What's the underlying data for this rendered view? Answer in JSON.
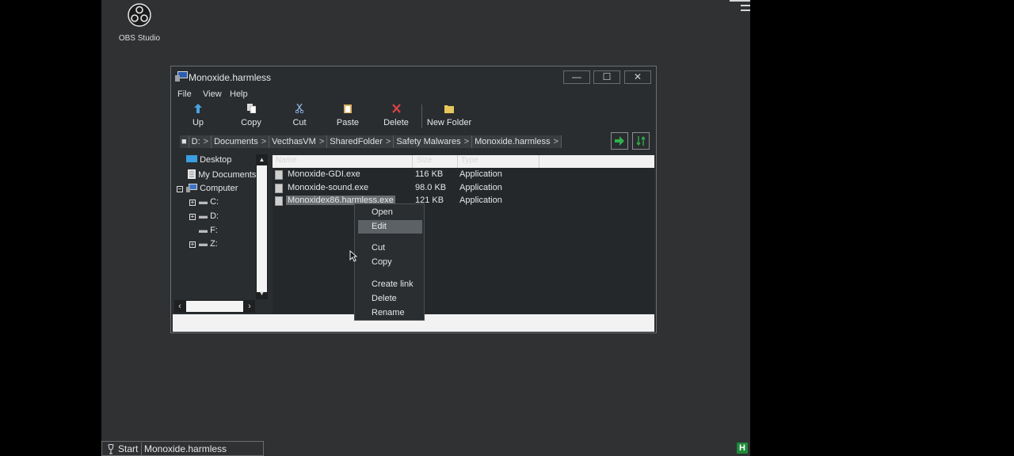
{
  "desktop": {
    "icons": [
      {
        "label": "OBS Studio",
        "icon": "obs-logo-icon"
      }
    ]
  },
  "window": {
    "title": "Monoxide.harmless",
    "controls": {
      "minimize": "—",
      "maximize": "☐",
      "close": "✕"
    },
    "menu": [
      "File",
      "View",
      "Help"
    ],
    "toolbar": [
      {
        "label": "Up",
        "icon": "up-arrow-icon"
      },
      {
        "label": "Copy",
        "icon": "copy-icon"
      },
      {
        "label": "Cut",
        "icon": "scissors-icon"
      },
      {
        "label": "Paste",
        "icon": "paste-icon"
      },
      {
        "label": "Delete",
        "icon": "delete-icon"
      },
      {
        "label": "New Folder",
        "icon": "folder-icon"
      }
    ],
    "address_bar": {
      "crumbs": [
        "D:",
        "Documents",
        "VecthasVM",
        "SharedFolder",
        "Safety Malwares",
        "Monoxide.harmless"
      ],
      "separator": ">"
    },
    "tree": {
      "items": [
        {
          "label": "Desktop"
        },
        {
          "label": "My Documents"
        },
        {
          "label": "Computer"
        },
        {
          "label": "C:"
        },
        {
          "label": "D:"
        },
        {
          "label": "F:"
        },
        {
          "label": "Z:"
        }
      ]
    },
    "file_list": {
      "columns": [
        "Name",
        "Size",
        "Type"
      ],
      "rows": [
        {
          "name": "Monoxide-GDI.exe",
          "size": "116 KB",
          "type": "Application"
        },
        {
          "name": "Monoxide-sound.exe",
          "size": "98.0 KB",
          "type": "Application"
        },
        {
          "name": "Monoxidex86.harmless.exe",
          "size": "121 KB",
          "type": "Application"
        }
      ],
      "selected_row": "Monoxidex86.harmless.exe"
    }
  },
  "context_menu": {
    "items": [
      "Open",
      "Edit",
      "Cut",
      "Copy",
      "Create link",
      "Delete",
      "Rename"
    ],
    "highlighted": "Edit"
  },
  "taskbar": {
    "start_label": "Start",
    "task_label": "Monoxide.harmless",
    "tray_icon": "H"
  },
  "colors": {
    "desktop_bg": "#2f3133",
    "window_bg": "#2a2d30",
    "status_green": "#1f8a3a"
  }
}
